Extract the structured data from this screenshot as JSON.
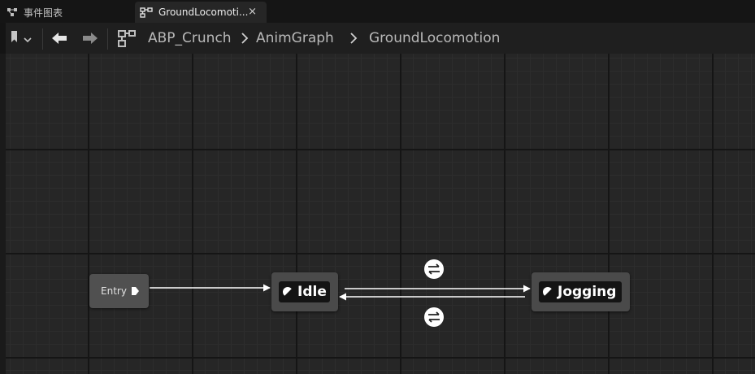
{
  "tabs": [
    {
      "label": "事件图表",
      "icon": "event-graph-icon",
      "active": false
    },
    {
      "label": "GroundLocomoti...",
      "icon": "state-machine-icon",
      "active": true,
      "close": "×"
    }
  ],
  "breadcrumb": {
    "icon": "state-machine-icon",
    "items": [
      "ABP_Crunch",
      "AnimGraph",
      "GroundLocomotion"
    ]
  },
  "graph": {
    "entry": {
      "label": "Entry"
    },
    "states": [
      {
        "label": "Idle"
      },
      {
        "label": "Jogging"
      }
    ],
    "transitions": [
      {
        "from": "Idle",
        "to": "Jogging"
      },
      {
        "from": "Jogging",
        "to": "Idle"
      }
    ]
  },
  "colors": {
    "wire": "#ffffff",
    "node": "#4a4a4a",
    "grid_major": "#151515"
  }
}
